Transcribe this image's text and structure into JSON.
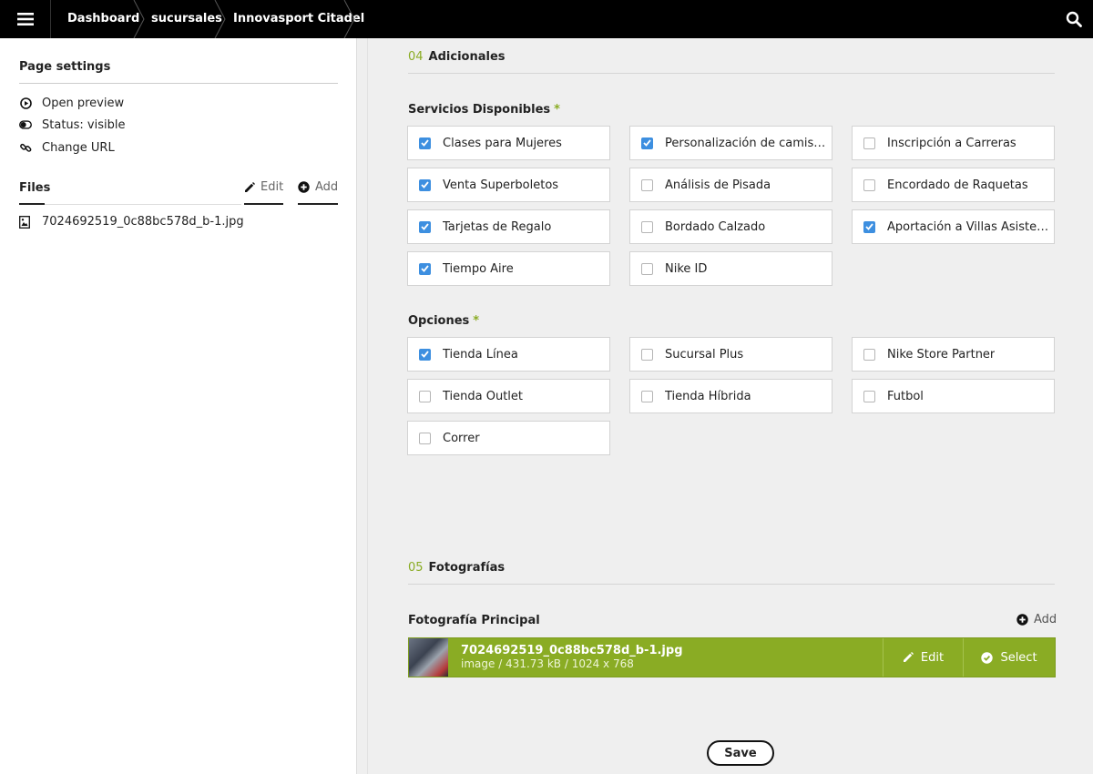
{
  "topbar": {
    "breadcrumbs": [
      "Dashboard",
      "sucursales",
      "Innovasport Citadel"
    ]
  },
  "sidebar": {
    "page_settings_title": "Page settings",
    "links": {
      "open_preview": "Open preview",
      "status": "Status: visible",
      "change_url": "Change URL"
    },
    "files_title": "Files",
    "edit_label": "Edit",
    "add_label": "Add",
    "file_name": "7024692519_0c88bc578d_b-1.jpg"
  },
  "main": {
    "section4": {
      "number": "04",
      "title": "Adicionales"
    },
    "servicios": {
      "label": "Servicios Disponibles",
      "required": "*",
      "items": [
        {
          "label": "Clases para Mujeres",
          "checked": true
        },
        {
          "label": "Personalización de camisetas",
          "checked": true
        },
        {
          "label": "Inscripción a Carreras",
          "checked": false
        },
        {
          "label": "Venta Superboletos",
          "checked": true
        },
        {
          "label": "Análisis de Pisada",
          "checked": false
        },
        {
          "label": "Encordado de Raquetas",
          "checked": false
        },
        {
          "label": "Tarjetas de Regalo",
          "checked": true
        },
        {
          "label": "Bordado Calzado",
          "checked": false
        },
        {
          "label": "Aportación a Villas Asistenci…",
          "checked": true
        },
        {
          "label": "Tiempo Aire",
          "checked": true
        },
        {
          "label": "Nike ID",
          "checked": false
        }
      ]
    },
    "opciones": {
      "label": "Opciones",
      "required": "*",
      "items": [
        {
          "label": "Tienda Línea",
          "checked": true
        },
        {
          "label": "Sucursal Plus",
          "checked": false
        },
        {
          "label": "Nike Store Partner",
          "checked": false
        },
        {
          "label": "Tienda Outlet",
          "checked": false
        },
        {
          "label": "Tienda Híbrida",
          "checked": false
        },
        {
          "label": "Futbol",
          "checked": false
        },
        {
          "label": "Correr",
          "checked": false
        }
      ]
    },
    "section5": {
      "number": "05",
      "title": "Fotografías"
    },
    "fotografia": {
      "label": "Fotografía Principal",
      "add_label": "Add",
      "file_name": "7024692519_0c88bc578d_b-1.jpg",
      "file_meta": "image / 431.73 kB / 1024 x 768",
      "edit_label": "Edit",
      "select_label": "Select"
    },
    "save_label": "Save"
  },
  "colors": {
    "accent_green": "#8aac24",
    "checkbox_blue": "#3d8fe0",
    "topbar": "#000000"
  }
}
